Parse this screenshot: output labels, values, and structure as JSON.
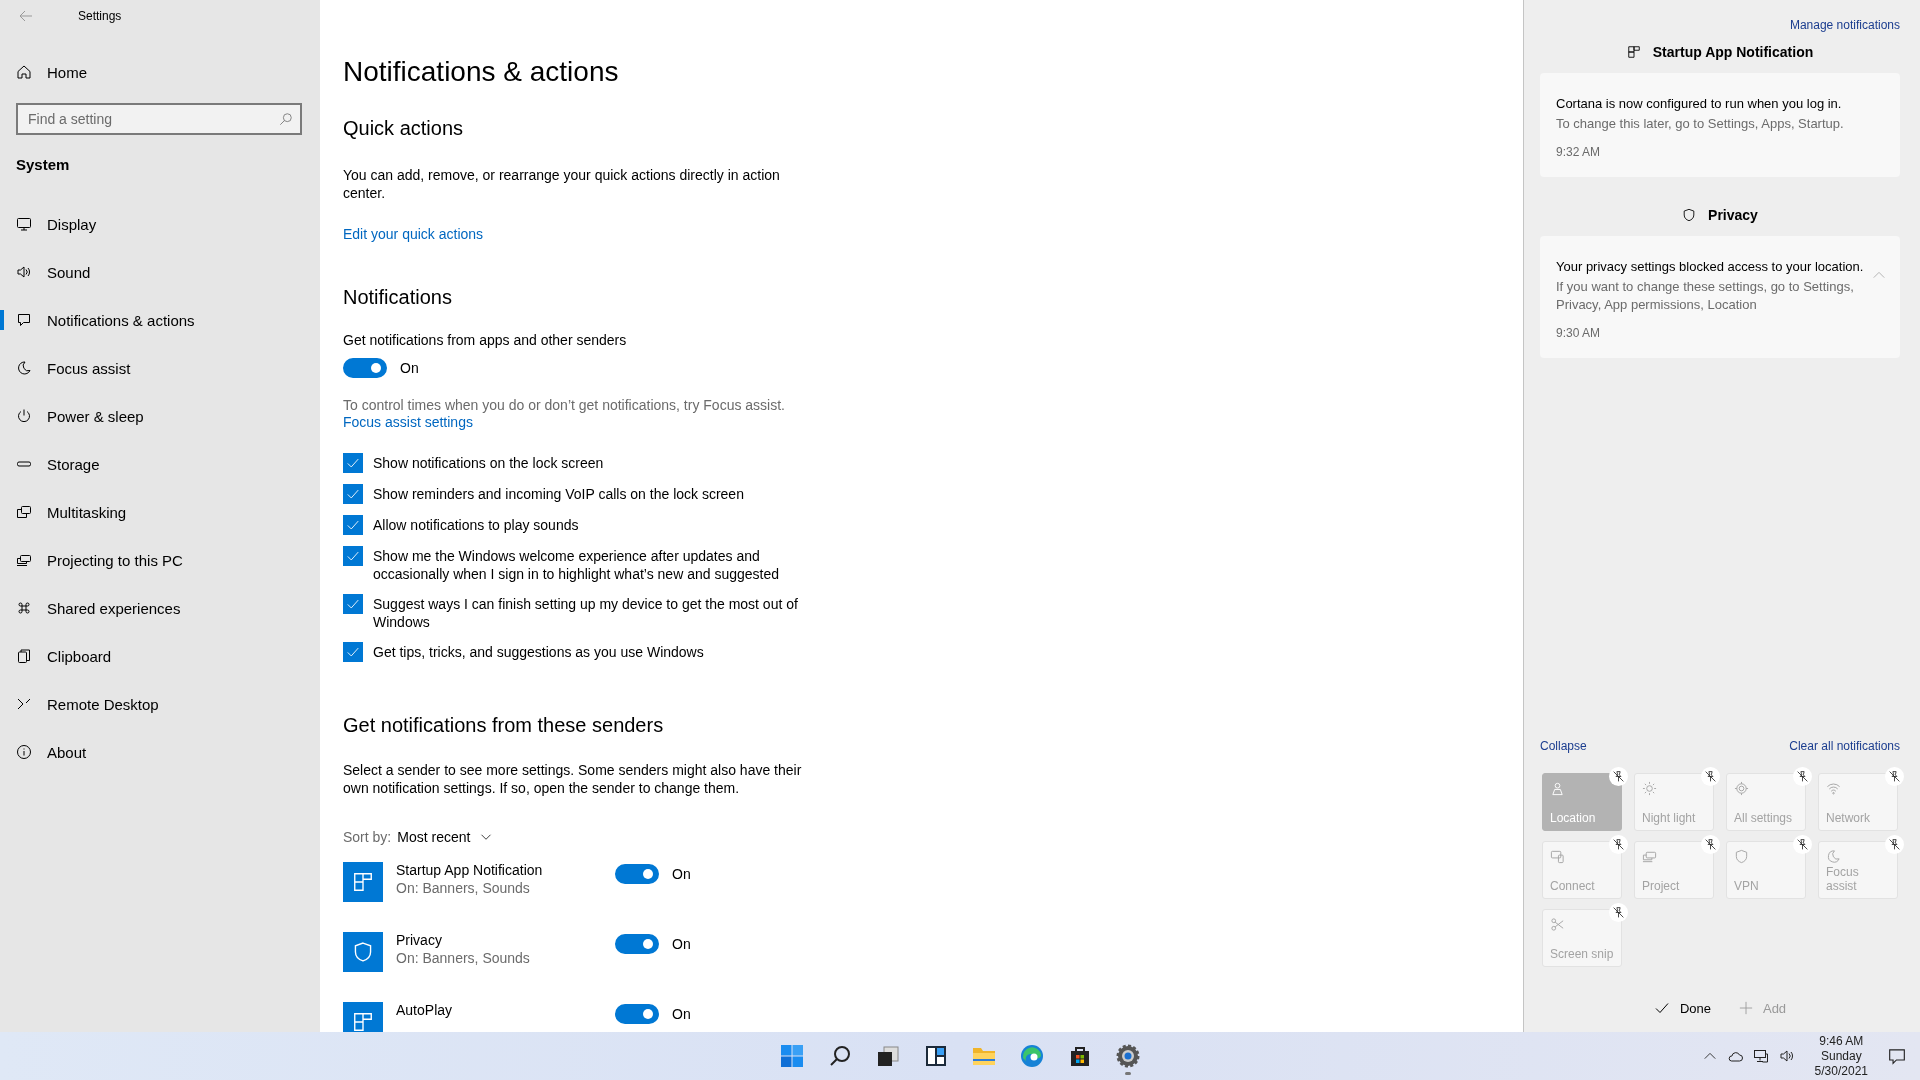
{
  "window": {
    "title": "Settings"
  },
  "sidebar": {
    "home": "Home",
    "search": {
      "placeholder": "Find a setting"
    },
    "section": "System",
    "items": [
      {
        "label": "Display",
        "selected": false
      },
      {
        "label": "Sound",
        "selected": false
      },
      {
        "label": "Notifications & actions",
        "selected": true
      },
      {
        "label": "Focus assist",
        "selected": false
      },
      {
        "label": "Power & sleep",
        "selected": false
      },
      {
        "label": "Storage",
        "selected": false
      },
      {
        "label": "Multitasking",
        "selected": false
      },
      {
        "label": "Projecting to this PC",
        "selected": false
      },
      {
        "label": "Shared experiences",
        "selected": false
      },
      {
        "label": "Clipboard",
        "selected": false
      },
      {
        "label": "Remote Desktop",
        "selected": false
      },
      {
        "label": "About",
        "selected": false
      }
    ]
  },
  "page": {
    "title": "Notifications & actions",
    "quick_actions": {
      "heading": "Quick actions",
      "description": "You can add, remove, or rearrange your quick actions directly in action center.",
      "link": "Edit your quick actions"
    },
    "notifications": {
      "heading": "Notifications",
      "toggle": {
        "label": "Get notifications from apps and other senders",
        "on": true,
        "state_text": "On"
      },
      "hint": "To control times when you do or don’t get notifications, try Focus assist.",
      "link": "Focus assist settings",
      "options": [
        {
          "label": "Show notifications on the lock screen",
          "checked": true
        },
        {
          "label": "Show reminders and incoming VoIP calls on the lock screen",
          "checked": true
        },
        {
          "label": "Allow notifications to play sounds",
          "checked": true
        },
        {
          "label": "Show me the Windows welcome experience after updates and occasionally when I sign in to highlight what’s new and suggested",
          "checked": true
        },
        {
          "label": "Suggest ways I can finish setting up my device to get the most out of Windows",
          "checked": true
        },
        {
          "label": "Get tips, tricks, and suggestions as you use Windows",
          "checked": true
        }
      ]
    },
    "senders": {
      "heading": "Get notifications from these senders",
      "description": "Select a sender to see more settings. Some senders might also have their own notification settings. If so, open the sender to change them.",
      "sort_label": "Sort by:",
      "sort_value": "Most recent",
      "items": [
        {
          "name": "Startup App Notification",
          "detail": "On: Banners, Sounds",
          "on": true,
          "state_text": "On"
        },
        {
          "name": "Privacy",
          "detail": "On: Banners, Sounds",
          "on": true,
          "state_text": "On"
        },
        {
          "name": "AutoPlay",
          "on": true,
          "state_text": "On"
        }
      ]
    }
  },
  "action_center": {
    "manage_link": "Manage notifications",
    "groups": [
      {
        "app": "Startup App Notification",
        "title": "Cortana is now configured to run when you log in.",
        "body": "To change this later, go to Settings, Apps, Startup.",
        "time": "9:32 AM",
        "expanded": false
      },
      {
        "app": "Privacy",
        "title": "Your privacy settings blocked access to your location.",
        "body": "If you want to change these settings, go to Settings, Privacy, App permissions, Location",
        "time": "9:30 AM",
        "expanded": true
      }
    ],
    "collapse": "Collapse",
    "clear_all": "Clear all notifications",
    "tiles": [
      {
        "label": "Location",
        "on": true
      },
      {
        "label": "Night light",
        "on": false
      },
      {
        "label": "All settings",
        "on": false
      },
      {
        "label": "Network",
        "on": false
      },
      {
        "label": "Connect",
        "on": false
      },
      {
        "label": "Project",
        "on": false
      },
      {
        "label": "VPN",
        "on": false
      },
      {
        "label": "Focus assist",
        "on": false
      },
      {
        "label": "Screen snip",
        "on": false
      }
    ],
    "done": "Done",
    "add": "Add"
  },
  "taskbar": {
    "apps": [
      {
        "running": false
      },
      {
        "running": false
      },
      {
        "running": false
      },
      {
        "running": false
      },
      {
        "running": false
      },
      {
        "running": false
      },
      {
        "running": false
      },
      {
        "running": true
      }
    ],
    "clock": {
      "time": "9:46 AM",
      "day": "Sunday",
      "date": "5/30/2021"
    }
  }
}
